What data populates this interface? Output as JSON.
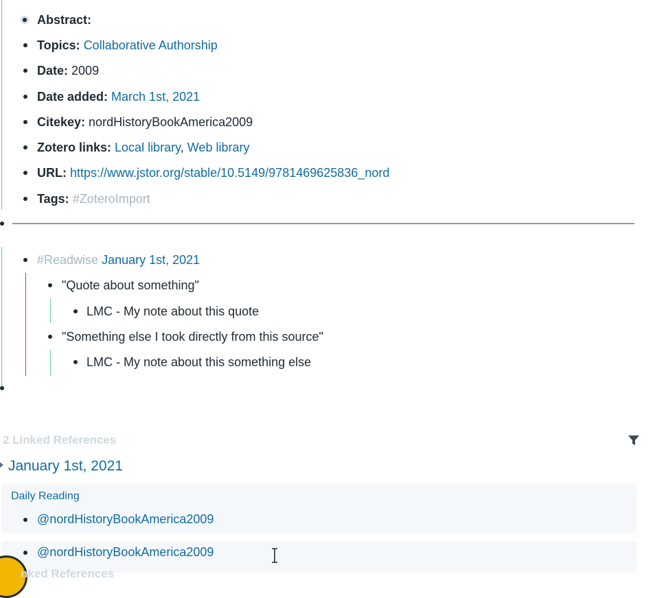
{
  "metadata": [
    {
      "key": "Abstract:",
      "value": "",
      "links": []
    },
    {
      "key": "Topics:",
      "value": "",
      "links": [
        "Collaborative Authorship"
      ]
    },
    {
      "key": "Date:",
      "value": "2009",
      "links": []
    },
    {
      "key": "Date added:",
      "value": "",
      "links": [
        "March 1st, 2021"
      ]
    },
    {
      "key": "Citekey:",
      "value": "nordHistoryBookAmerica2009",
      "links": []
    },
    {
      "key": "Zotero links:",
      "value": "",
      "links": [
        "Local library",
        "Web library"
      ]
    },
    {
      "key": "URL:",
      "value": "",
      "links": [
        "https://www.jstor.org/stable/10.5149/9781469625836_nord"
      ]
    },
    {
      "key": "Tags:",
      "value": "",
      "tag": "#ZoteroImport"
    }
  ],
  "readwise": {
    "tag": "#Readwise",
    "date": "January 1st, 2021",
    "quotes": [
      {
        "text": "\"Quote about something\"",
        "note": "LMC - My note about this quote"
      },
      {
        "text": "\"Something else I took directly from this source\"",
        "note": "LMC - My note about this something else"
      }
    ]
  },
  "linked_refs": {
    "heading": "2 Linked References",
    "group_title": "January 1st, 2021",
    "breadcrumb": "Daily Reading",
    "items": [
      "@nordHistoryBookAmerica2009",
      "@nordHistoryBookAmerica2009"
    ]
  },
  "partial_text": "nked References",
  "colors": {
    "accent_green": "#5ad1a8",
    "accent_red": "#c73e3e",
    "link": "#106ba3",
    "tag": "#a7b6c2"
  }
}
